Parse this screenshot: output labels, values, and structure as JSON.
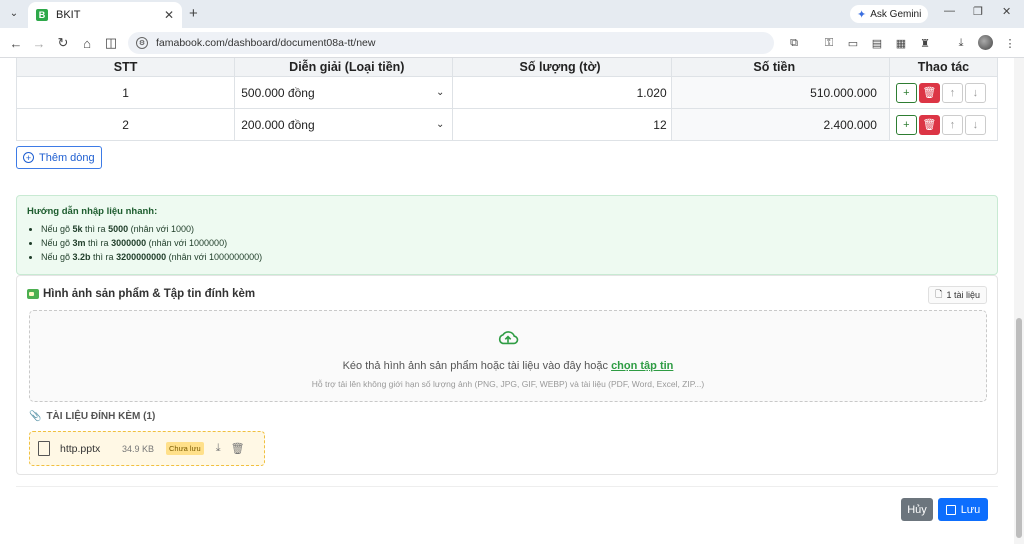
{
  "browser": {
    "tab_title": "BKIT",
    "favicon_letter": "B",
    "url": "famabook.com/dashboard/document08a-tt/new",
    "gemini_label": "Ask Gemini"
  },
  "table": {
    "headers": [
      "STT",
      "Diễn giải (Loại tiền)",
      "Số lượng (tờ)",
      "Số tiền",
      "Thao tác"
    ],
    "rows": [
      {
        "stt": "1",
        "desc": "500.000 đồng",
        "qty": "1.020",
        "amount": "510.000.000"
      },
      {
        "stt": "2",
        "desc": "200.000 đồng",
        "qty": "12",
        "amount": "2.400.000"
      }
    ]
  },
  "add_row_label": "Thêm dòng",
  "guide": {
    "title": "Hướng dẫn nhập liệu nhanh:",
    "items": [
      {
        "pre": "Nếu gõ ",
        "key": "5k",
        "mid": " thì ra ",
        "val": "5000",
        "post": " (nhân với 1000)"
      },
      {
        "pre": "Nếu gõ ",
        "key": "3m",
        "mid": " thì ra ",
        "val": "3000000",
        "post": " (nhân với 1000000)"
      },
      {
        "pre": "Nếu gõ ",
        "key": "3.2b",
        "mid": " thì ra ",
        "val": "3200000000",
        "post": " (nhân với 1000000000)"
      }
    ]
  },
  "attachments": {
    "title": "Hình ảnh sản phẩm & Tập tin đính kèm",
    "count_label": "1 tài liệu",
    "drop_text": "Kéo thả hình ảnh sản phẩm hoặc tài liệu vào đây hoặc ",
    "drop_link": "chọn tập tin",
    "drop_sub": "Hỗ trợ tải lên không giới hạn số lượng ảnh (PNG, JPG, GIF, WEBP) và tài liệu (PDF, Word, Excel, ZIP...)",
    "files_title": "TÀI LIỆU ĐÍNH KÈM (1)",
    "files": [
      {
        "name": "http.pptx",
        "size": "34.9 KB",
        "status": "Chưa lưu"
      }
    ]
  },
  "actions": {
    "cancel": "Hủy",
    "save": "Lưu"
  }
}
